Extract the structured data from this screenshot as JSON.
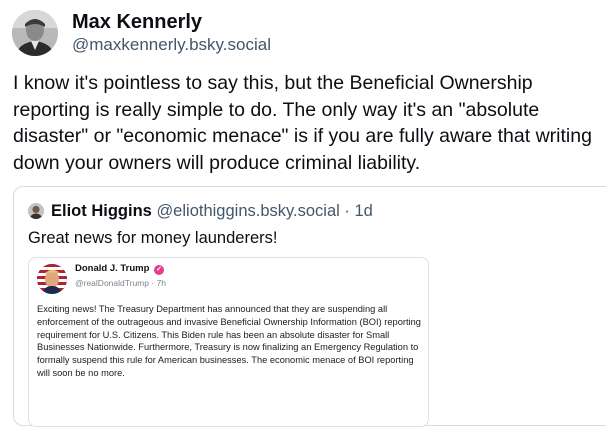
{
  "post": {
    "author_name": "Max Kennerly",
    "author_handle": "@maxkennerly.bsky.social",
    "text": "I know it's pointless to say this, but the Beneficial Ownership reporting is really simple to do. The only way it's an \"absolute disaster\" or \"economic menace\" is if you are fully aware that writing down your owners will produce criminal liability."
  },
  "quote": {
    "author_name": "Eliot Higgins",
    "author_handle": "@eliothiggins.bsky.social",
    "separator": "·",
    "time": "1d",
    "text": "Great news for money launderers!",
    "embed": {
      "author_name": "Donald J. Trump",
      "author_handle": "@realDonaldTrump",
      "separator": "·",
      "time": "7h",
      "text": "Exciting news! The Treasury Department has announced that they are suspending all enforcement of the outrageous and invasive Beneficial Ownership Information (BOI) reporting requirement for U.S. Citizens. This Biden rule has been an absolute disaster for Small Businesses Nationwide. Furthermore, Treasury is now finalizing an Emergency Regulation to formally suspend this rule for American businesses. The economic menace of BOI reporting will soon be no more."
    }
  },
  "icons": {
    "author_avatar": "avatar",
    "quote_avatar": "avatar",
    "embed_avatar": "avatar",
    "verified": "verified-badge-icon"
  },
  "colors": {
    "text_primary": "#0b0f14",
    "text_secondary": "#42576c",
    "border": "#d4dbe2",
    "verified_badge": "#e83b8e"
  }
}
